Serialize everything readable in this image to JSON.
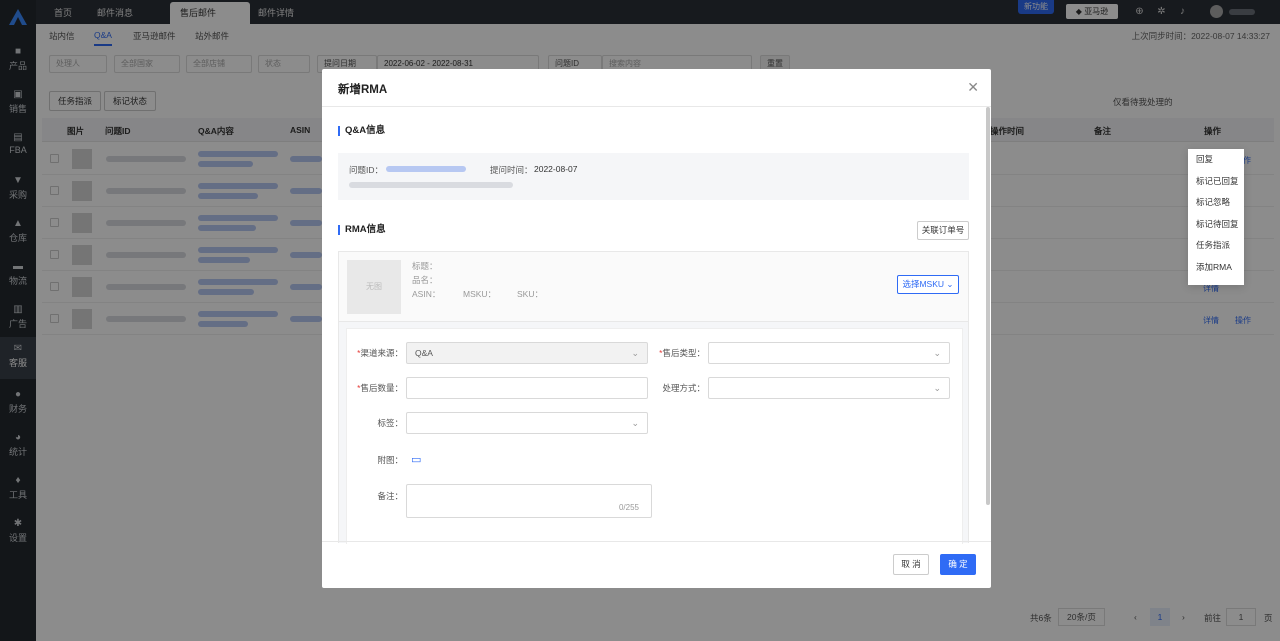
{
  "sidebar": {
    "items": [
      {
        "label": "产品",
        "icon": "cube-icon"
      },
      {
        "label": "销售",
        "icon": "bag-icon"
      },
      {
        "label": "FBA",
        "icon": "box-icon"
      },
      {
        "label": "采购",
        "icon": "cart-icon"
      },
      {
        "label": "仓库",
        "icon": "warehouse-icon"
      },
      {
        "label": "物流",
        "icon": "truck-icon"
      },
      {
        "label": "广告",
        "icon": "chart-icon"
      },
      {
        "label": "客服",
        "icon": "mail-icon"
      },
      {
        "label": "财务",
        "icon": "coin-icon"
      },
      {
        "label": "统计",
        "icon": "pie-icon"
      },
      {
        "label": "工具",
        "icon": "tool-icon"
      },
      {
        "label": "设置",
        "icon": "gear-icon"
      }
    ]
  },
  "topbar": {
    "tabs": [
      "首页",
      "邮件消息",
      "售后邮件",
      "邮件详情"
    ],
    "new_feature": "新功能",
    "amazon_button": "亚马逊"
  },
  "subtabs": [
    "站内信",
    "Q&A",
    "亚马逊邮件",
    "站外邮件"
  ],
  "sync_text": "上次同步时间：2022-08-07 14:33:27",
  "filters": {
    "handler": "处理人",
    "country": "全部国家",
    "shop": "全部店铺",
    "status": "状态",
    "date_type": "提问日期",
    "date_start": "2022-06-02",
    "date_sep": "-",
    "date_end": "2022-08-31",
    "search_type": "问题ID",
    "search_placeholder": "搜索内容",
    "reset": "重置"
  },
  "toolbar": {
    "assign": "任务指派",
    "mark": "标记状态",
    "only_mine": "仅看待我处理的"
  },
  "table": {
    "columns": [
      "图片",
      "问题ID",
      "Q&A内容",
      "ASIN",
      "操作时间",
      "备注",
      "操作"
    ],
    "rows": [
      {
        "detail": "详情",
        "action": "操作"
      },
      {
        "detail": "详情",
        "action": ""
      },
      {
        "detail": "详情",
        "action": ""
      },
      {
        "detail": "详情",
        "action": ""
      },
      {
        "detail": "详情",
        "action": ""
      },
      {
        "detail": "详情",
        "action": "操作"
      }
    ]
  },
  "action_menu": [
    "回复",
    "标记已回复",
    "标记忽略",
    "标记待回复",
    "任务指派",
    "添加RMA"
  ],
  "pager": {
    "total": "共6条",
    "page_size": "20条/页",
    "current": "1",
    "goto_label": "前往",
    "goto_value": "1",
    "page_suffix": "页"
  },
  "modal": {
    "title": "新增RMA",
    "qa_section": "Q&A信息",
    "question_id_label": "问题ID：",
    "ask_time_label": "提问时间：",
    "ask_time": "2022-08-07",
    "rma_section": "RMA信息",
    "link_order": "关联订单号",
    "product": {
      "placeholder": "无图",
      "title_label": "标题：",
      "name_label": "品名：",
      "asin_label": "ASIN：",
      "msku_label": "MSKU：",
      "sku_label": "SKU：",
      "choose_msku": "选择MSKU"
    },
    "form": {
      "channel_label": "渠道来源：",
      "channel_value": "Q&A",
      "type_label": "售后类型：",
      "qty_label": "售后数量：",
      "method_label": "处理方式：",
      "tag_label": "标签：",
      "attach_label": "附图：",
      "remark_label": "备注：",
      "remark_count": "0/255"
    },
    "cancel": "取 消",
    "confirm": "确 定"
  }
}
